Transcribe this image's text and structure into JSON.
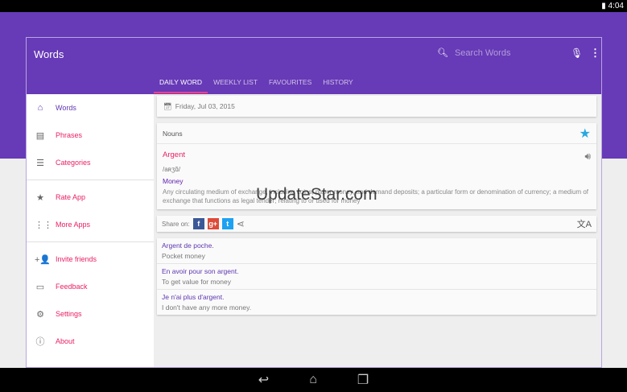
{
  "status": {
    "time": "4:04"
  },
  "app": {
    "title": "Words",
    "search_placeholder": "Search Words"
  },
  "tabs": [
    {
      "label": "DAILY WORD",
      "active": true
    },
    {
      "label": "WEEKLY LIST"
    },
    {
      "label": "FAVOURITES"
    },
    {
      "label": "HISTORY"
    }
  ],
  "sidebar": {
    "items": [
      {
        "label": "Words",
        "icon": "⌂"
      },
      {
        "label": "Phrases",
        "icon": "▤"
      },
      {
        "label": "Categories",
        "icon": "☰"
      },
      {
        "label": "Rate App",
        "icon": "★"
      },
      {
        "label": "More Apps",
        "icon": "⋮⋮"
      },
      {
        "label": "Invite friends",
        "icon": "+👤"
      },
      {
        "label": "Feedback",
        "icon": "▭"
      },
      {
        "label": "Settings",
        "icon": "⚙"
      },
      {
        "label": "About",
        "icon": "ⓘ"
      }
    ]
  },
  "daily": {
    "date": "Friday, Jul 03, 2015",
    "section": "Nouns",
    "word": "Argent",
    "pronunciation": "/aʀʒɑ̃/",
    "meaning": "Money",
    "definition": "Any circulating medium of exchange, including coins, paper money, and demand deposits; a particular form or denomination of currency; a medium of exchange that functions as legal tender; relating to or used for money"
  },
  "share": {
    "label": "Share on:"
  },
  "examples": [
    {
      "fr": "Argent de poche.",
      "en": "Pocket money"
    },
    {
      "fr": "En avoir pour son argent.",
      "en": "To get value for money"
    },
    {
      "fr": "Je n'ai plus d'argent.",
      "en": "I don't have any more money."
    }
  ],
  "watermark": "UpdateStar.com",
  "colors": {
    "primary": "#673ab7",
    "accent": "#e91e63",
    "star": "#29a8e0"
  }
}
